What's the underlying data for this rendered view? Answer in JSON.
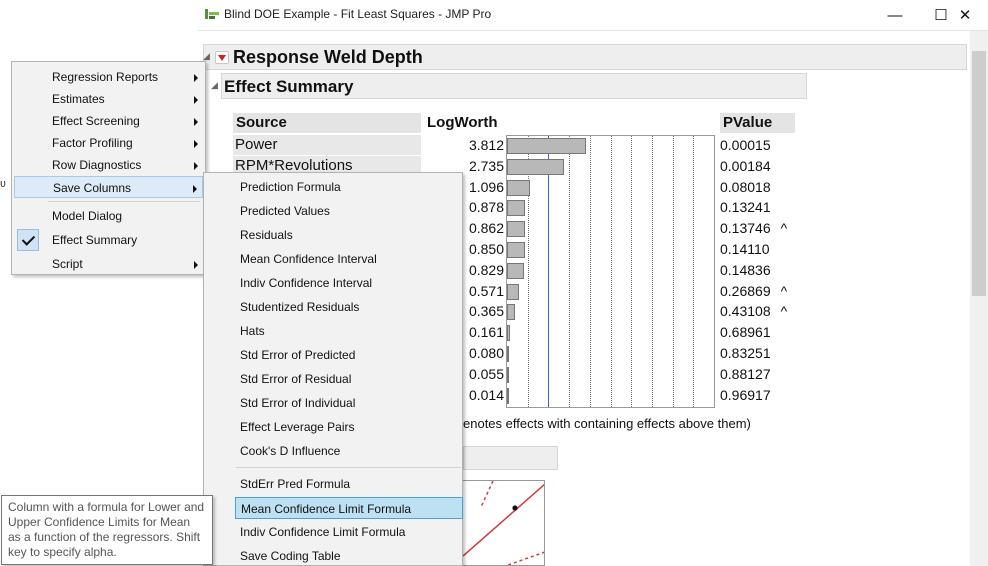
{
  "window": {
    "title": "Blind DOE Example - Fit Least Squares - JMP Pro",
    "minimize": "—",
    "maximize": "☐",
    "close": "✕"
  },
  "report": {
    "response_title": "Response Weld Depth",
    "effect_summary_title": "Effect Summary",
    "columns": {
      "source": "Source",
      "logworth": "LogWorth",
      "pvalue": "PValue"
    },
    "rows": [
      {
        "source": "Power",
        "logworth": "3.812",
        "pvalue": "0.00015",
        "flag": ""
      },
      {
        "source": "RPM*Revolutions",
        "logworth": "2.735",
        "pvalue": "0.00184",
        "flag": ""
      },
      {
        "source": "",
        "logworth": "1.096",
        "pvalue": "0.08018",
        "flag": ""
      },
      {
        "source": "",
        "logworth": "0.878",
        "pvalue": "0.13241",
        "flag": ""
      },
      {
        "source": "",
        "logworth": "0.862",
        "pvalue": "0.13746",
        "flag": "^"
      },
      {
        "source": "",
        "logworth": "0.850",
        "pvalue": "0.14110",
        "flag": ""
      },
      {
        "source": "",
        "logworth": "0.829",
        "pvalue": "0.14836",
        "flag": ""
      },
      {
        "source": "",
        "logworth": "0.571",
        "pvalue": "0.26869",
        "flag": "^"
      },
      {
        "source": "",
        "logworth": "0.365",
        "pvalue": "0.43108",
        "flag": "^"
      },
      {
        "source": "",
        "logworth": "0.161",
        "pvalue": "0.68961",
        "flag": ""
      },
      {
        "source": "",
        "logworth": "0.080",
        "pvalue": "0.83251",
        "flag": ""
      },
      {
        "source": "",
        "logworth": "0.055",
        "pvalue": "0.88127",
        "flag": ""
      },
      {
        "source": "",
        "logworth": "0.014",
        "pvalue": "0.96917",
        "flag": ""
      }
    ],
    "footnote": "enotes effects with containing effects above them)"
  },
  "main_menu": {
    "items": [
      {
        "label": "Regression Reports",
        "submenu": true
      },
      {
        "label": "Estimates",
        "submenu": true
      },
      {
        "label": "Effect Screening",
        "submenu": true
      },
      {
        "label": "Factor Profiling",
        "submenu": true
      },
      {
        "label": "Row Diagnostics",
        "submenu": true
      },
      {
        "label": "Save Columns",
        "submenu": true,
        "highlighted": true
      },
      {
        "label": "Model Dialog",
        "submenu": false
      },
      {
        "label": "Effect Summary",
        "submenu": false,
        "checked": true
      },
      {
        "label": "Script",
        "submenu": true
      }
    ]
  },
  "save_columns_submenu": {
    "items": [
      "Prediction Formula",
      "Predicted Values",
      "Residuals",
      "Mean Confidence Interval",
      "Indiv Confidence Interval",
      "Studentized Residuals",
      "Hats",
      "Std Error of Predicted",
      "Std Error of Residual",
      "Std Error of Individual",
      "Effect Leverage Pairs",
      "Cook's D Influence",
      "StdErr Pred Formula",
      "Mean Confidence Limit Formula",
      "Indiv Confidence Limit Formula",
      "Save Coding Table"
    ],
    "hovered": "Mean Confidence Limit Formula"
  },
  "tooltip": {
    "text": "Column with a formula for Lower and Upper Confidence Limits for Mean as a function of the regressors. Shift key to specify alpha."
  },
  "chart_data": {
    "type": "bar",
    "categories": [
      "Power",
      "RPM*Revolutions",
      "",
      "",
      "",
      "",
      "",
      "",
      "",
      "",
      "",
      "",
      ""
    ],
    "values": [
      3.812,
      2.735,
      1.096,
      0.878,
      0.862,
      0.85,
      0.829,
      0.571,
      0.365,
      0.161,
      0.08,
      0.055,
      0.014
    ],
    "xlim": [
      0,
      10
    ],
    "reference_line": 2,
    "grid": true,
    "colors": {
      "bar": "#b8b8b8",
      "reference": "#4060c8"
    }
  }
}
